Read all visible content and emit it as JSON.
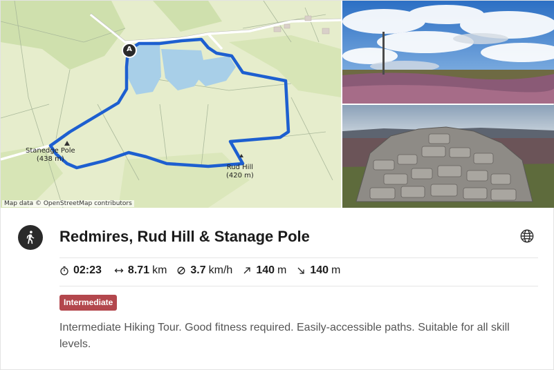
{
  "map": {
    "attribution": "Map data © OpenStreetMap contributors",
    "start_marker": "A",
    "labels": [
      {
        "name": "Stanedge Pole",
        "sub": "(438 m)"
      },
      {
        "name": "Rud Hill",
        "sub": "(420 m)"
      }
    ],
    "colors": {
      "route": "#1d5fd0",
      "water": "#a8cfe8",
      "land": "#e4ecc9",
      "forest": "#d3e2b0",
      "road": "#ffffff"
    }
  },
  "photos": [
    {
      "icon": "moorland-trig-pole-photo"
    },
    {
      "icon": "stone-cairn-photo"
    }
  ],
  "tour": {
    "title": "Redmires, Rud Hill & Stanage Pole",
    "sport_icon": "hiking-person-icon",
    "stats": [
      {
        "icon": "stopwatch-icon",
        "value": "02:23",
        "unit": ""
      },
      {
        "icon": "horizontal-arrows-icon",
        "value": "8.71",
        "unit": "km"
      },
      {
        "icon": "average-speed-icon",
        "value": "3.7",
        "unit": "km/h"
      },
      {
        "icon": "arrow-up-right-icon",
        "value": "140",
        "unit": "m"
      },
      {
        "icon": "arrow-down-right-icon",
        "value": "140",
        "unit": "m"
      }
    ],
    "difficulty": "Intermediate",
    "description": "Intermediate Hiking Tour. Good fitness required. Easily-accessible paths. Suitable for all skill levels."
  },
  "colors": {
    "badge": "#b3474d",
    "text": "#1b1b1b",
    "muted": "#555555"
  }
}
